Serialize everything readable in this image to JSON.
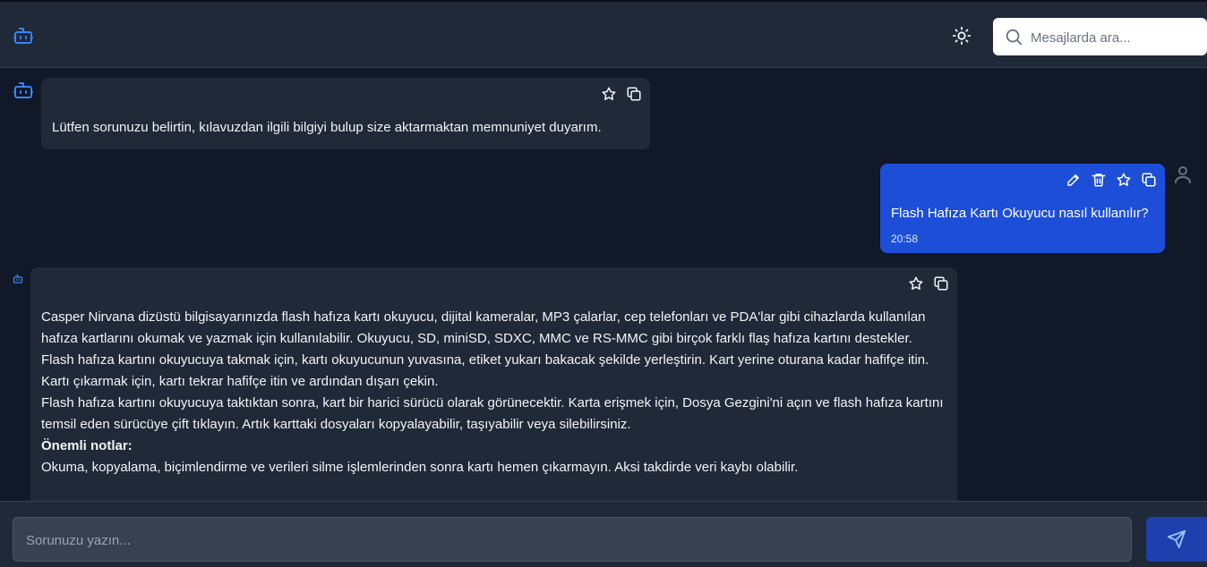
{
  "header": {
    "search_placeholder": "Mesajlarda ara...",
    "logo_icon": "bot-icon",
    "theme_icon": "sun-icon"
  },
  "messages": [
    {
      "role": "bot",
      "text": "Lütfen sorunuzu belirtin, kılavuzdan ilgili bilgiyi bulup size aktarmaktan memnuniyet duyarım.",
      "actions": [
        "star-icon",
        "copy-icon"
      ]
    },
    {
      "role": "user",
      "text": "Flash Hafıza Kartı Okuyucu nasıl kullanılır?",
      "time": "20:58",
      "actions": [
        "edit-icon",
        "trash-icon",
        "star-icon",
        "copy-icon"
      ]
    },
    {
      "role": "bot",
      "paragraphs": [
        "Casper Nirvana dizüstü bilgisayarınızda flash hafıza kartı okuyucu, dijital kameralar, MP3 çalarlar, cep telefonları ve PDA'lar gibi cihazlarda kullanılan hafıza kartlarını okumak ve yazmak için kullanılabilir. Okuyucu, SD, miniSD, SDXC, MMC ve RS-MMC gibi birçok farklı flaş hafıza kartını destekler.",
        "Flash hafıza kartını okuyucuya takmak için, kartı okuyucunun yuvasına, etiket yukarı bakacak şekilde yerleştirin. Kart yerine oturana kadar hafifçe itin. Kartı çıkarmak için, kartı tekrar hafifçe itin ve ardından dışarı çekin.",
        "Flash hafıza kartını okuyucuya taktıktan sonra, kart bir harici sürücü olarak görünecektir. Karta erişmek için, Dosya Gezgini'ni açın ve flash hafıza kartını temsil eden sürücüye çift tıklayın. Artık karttaki dosyaları kopyalayabilir, taşıyabilir veya silebilirsiniz.",
        "Önemli notlar:",
        "Okuma, kopyalama, biçimlendirme ve verileri silme işlemlerinden sonra kartı hemen çıkarmayın. Aksi takdirde veri kaybı olabilir."
      ],
      "actions": [
        "star-icon",
        "copy-icon"
      ]
    }
  ],
  "composer": {
    "placeholder": "Sorunuzu yazın...",
    "send_icon": "send-icon"
  }
}
